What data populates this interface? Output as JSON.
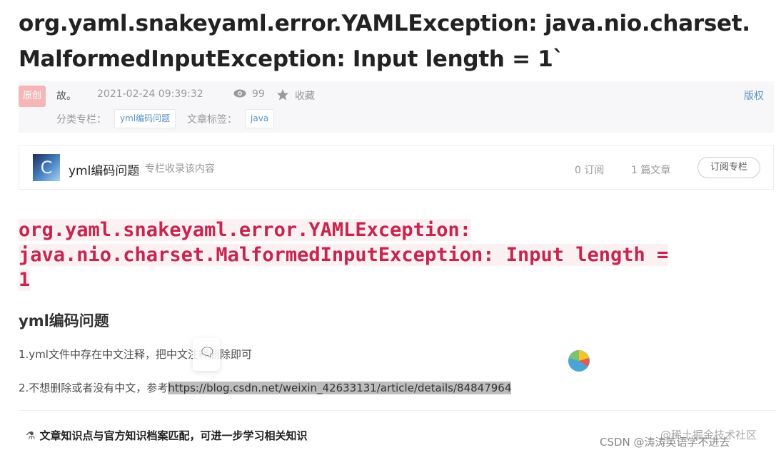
{
  "article": {
    "title": "org.yaml.snakeyaml.error.YAMLException: java.nio.charset.MalformedInputException: Input length = 1`"
  },
  "meta": {
    "badge": "原创",
    "author": "故。",
    "date": "2021-02-24 09:39:32",
    "views": "99",
    "favorite": "收藏",
    "copyright": "版权",
    "category_label": "分类专栏：",
    "category": "yml编码问题",
    "tag_label": "文章标签：",
    "tag": "java"
  },
  "column": {
    "avatar_letter": "C",
    "name": "yml编码问题",
    "desc": "专栏收录该内容",
    "subscribers": "0 订阅",
    "articles": "1 篇文章",
    "subscribe_button": "订阅专栏"
  },
  "content": {
    "code_title_line1": "org.yaml.snakeyaml.error.YAMLException:",
    "code_title_line2": "java.nio.charset.MalformedInputException: Input length =",
    "code_title_line3": "1",
    "heading": "yml编码问题",
    "p1": "1.yml文件中存在中文注释，把中文注释删除即可",
    "p2_prefix": "2.不想删除或者没有中文，参考",
    "p2_url": "https://blog.csdn.net/weixin_42633131/article/details/84847964",
    "knowledge": "文章知识点与官方知识档案匹配，可进一步学习相关知识"
  },
  "watermark": {
    "csdn": "CSDN @涛涛英语学不进去",
    "juejin": "@稀土掘金技术社区"
  },
  "colors": {
    "code": "#c7254e",
    "link": "#5893c2",
    "badge": "#f4b6b6"
  }
}
